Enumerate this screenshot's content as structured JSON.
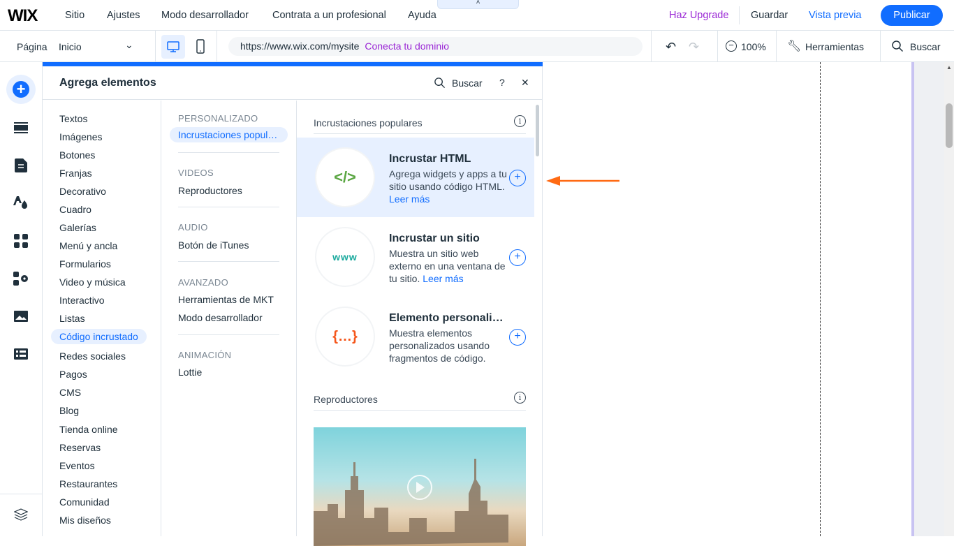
{
  "topbar": {
    "logo": "WIX",
    "menu": [
      "Sitio",
      "Ajustes",
      "Modo desarrollador",
      "Contrata a un profesional",
      "Ayuda"
    ],
    "upgrade": "Haz Upgrade",
    "save": "Guardar",
    "preview": "Vista previa",
    "publish": "Publicar",
    "collapse": "˄"
  },
  "subbar": {
    "page_label": "Página",
    "page_value": "Inicio",
    "url": "https://www.wix.com/mysite",
    "connect": "Conecta tu dominio",
    "zoom": "100%",
    "tools": "Herramientas",
    "search": "Buscar"
  },
  "panel": {
    "title": "Agrega elementos",
    "search": "Buscar",
    "help": "?",
    "close": "✕",
    "categories": [
      "Textos",
      "Imágenes",
      "Botones",
      "Franjas",
      "Decorativo",
      "Cuadro",
      "Galerías",
      "Menú y ancla",
      "Formularios",
      "Video y música",
      "Interactivo",
      "Listas",
      "Código incrustado",
      "Redes sociales",
      "Pagos",
      "CMS",
      "Blog",
      "Tienda online",
      "Reservas",
      "Eventos",
      "Restaurantes",
      "Comunidad",
      "Mis diseños"
    ],
    "sub": {
      "h1": "PERSONALIZADO",
      "i1": "Incrustaciones populares",
      "h2": "VIDEOS",
      "i2": "Reproductores",
      "h3": "AUDIO",
      "i3": "Botón de iTunes",
      "h4": "AVANZADO",
      "i4a": "Herramientas de MKT",
      "i4b": "Modo desarrollador",
      "h5": "ANIMACIÓN",
      "i5": "Lottie"
    },
    "section1": "Incrustaciones populares",
    "section2": "Reproductores",
    "cards": [
      {
        "icon": "</>",
        "title": "Incrustar HTML",
        "desc": "Agrega widgets y apps a tu sitio usando código HTML.",
        "link": "Leer más"
      },
      {
        "icon": "www",
        "title": "Incrustar un sitio",
        "desc": "Muestra un sitio web externo en una ventana de tu sitio.",
        "link": "Leer más"
      },
      {
        "icon": "{…}",
        "title": "Elemento personalizado",
        "desc": "Muestra elementos personalizados usando fragmentos de código.",
        "link": ""
      }
    ]
  },
  "colors": {
    "accent": "#116dff",
    "upgrade": "#9a27d5",
    "arrow": "#ff6a13"
  }
}
